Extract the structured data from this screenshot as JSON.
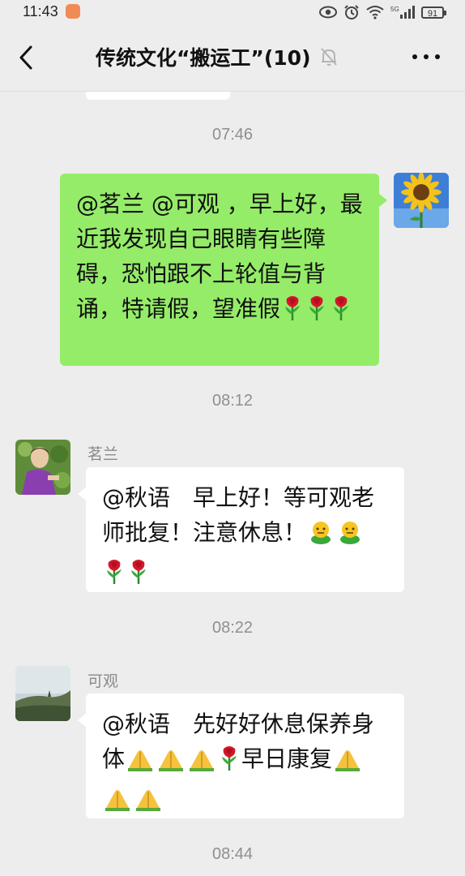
{
  "status_bar": {
    "time": "11:43",
    "app_badge_icon": "orange-app-icon",
    "signal_label": "5G",
    "battery": "91"
  },
  "header": {
    "title": "传统文化“搬运工”(10)",
    "back_icon": "chevron-left-icon",
    "mute_icon": "bell-off-icon",
    "more_icon": "ellipsis-icon"
  },
  "messages": [
    {
      "timestamp": "07:46",
      "sender": "self",
      "avatar": "sunflower",
      "text": "@茗兰 @可观 ，早上好，最近我发现自己眼睛有些障碍，恐怕跟不上轮值与背诵，特请假，望准假"
    },
    {
      "timestamp": "08:12",
      "sender": "茗兰",
      "avatar": "person-in-garden",
      "text": "@秋语　早上好！等可观老师批复！注意休息！"
    },
    {
      "timestamp": "08:22",
      "sender": "可观",
      "avatar": "landscape-hill",
      "text_1": "@秋语　先好好休息保养身体",
      "text_2": "早日康复"
    },
    {
      "timestamp": "08:44"
    }
  ],
  "colors": {
    "background": "#ededed",
    "self_bubble": "#95ec69",
    "other_bubble": "#ffffff",
    "timestamp": "#8f8f8f"
  }
}
